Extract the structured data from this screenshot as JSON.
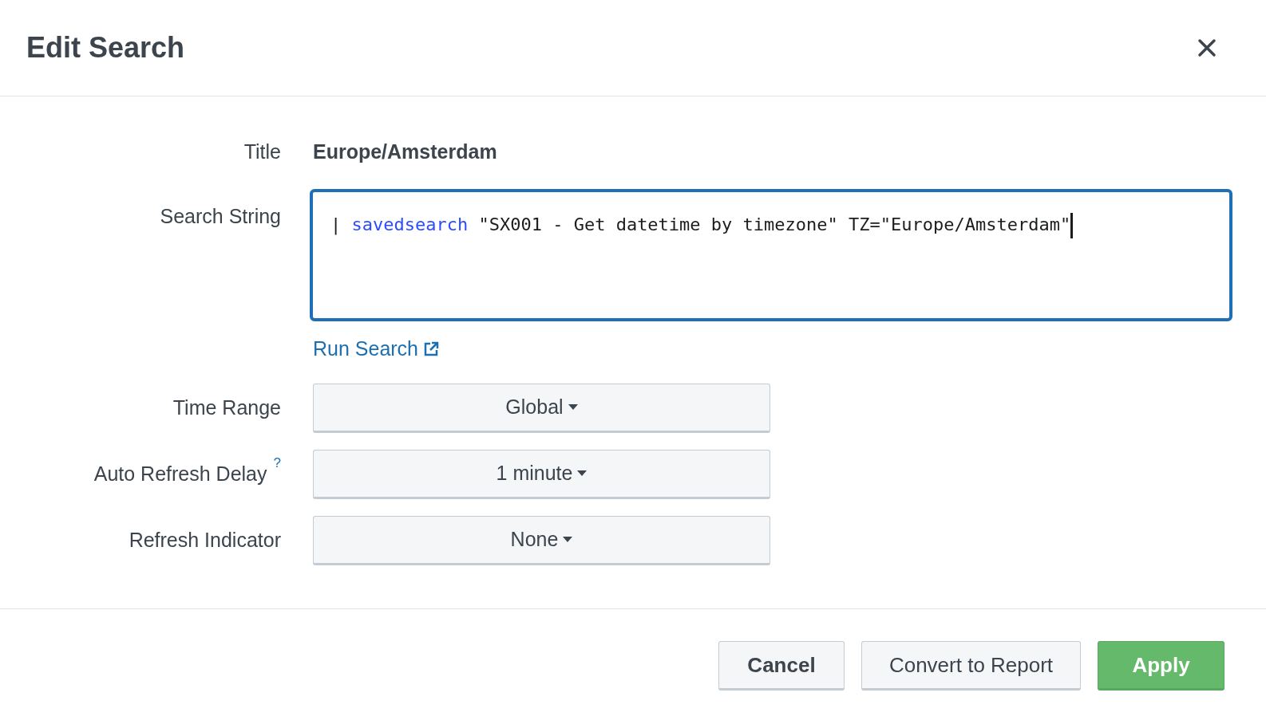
{
  "dialog": {
    "title": "Edit Search"
  },
  "title_field": {
    "label": "Title",
    "value": "Europe/Amsterdam"
  },
  "search_string": {
    "label": "Search String",
    "focused": true,
    "tokens": [
      {
        "kind": "pipe",
        "text": "|"
      },
      {
        "kind": "command",
        "text": "savedsearch"
      },
      {
        "kind": "plain",
        "text": "\"SX001 - Get datetime by timezone\" TZ=\"Europe/Amsterdam\""
      }
    ]
  },
  "run_search_link": "Run Search",
  "dropdowns": [
    {
      "label": "Time Range",
      "value": "Global"
    },
    {
      "label": "Auto Refresh Delay",
      "help": "?",
      "value": "1 minute"
    },
    {
      "label": "Refresh Indicator",
      "value": "None"
    }
  ],
  "buttons": [
    {
      "label": "Cancel",
      "kind": "default"
    },
    {
      "label": "Convert to Report",
      "kind": "secondary"
    },
    {
      "label": "Apply",
      "kind": "primary"
    }
  ]
}
